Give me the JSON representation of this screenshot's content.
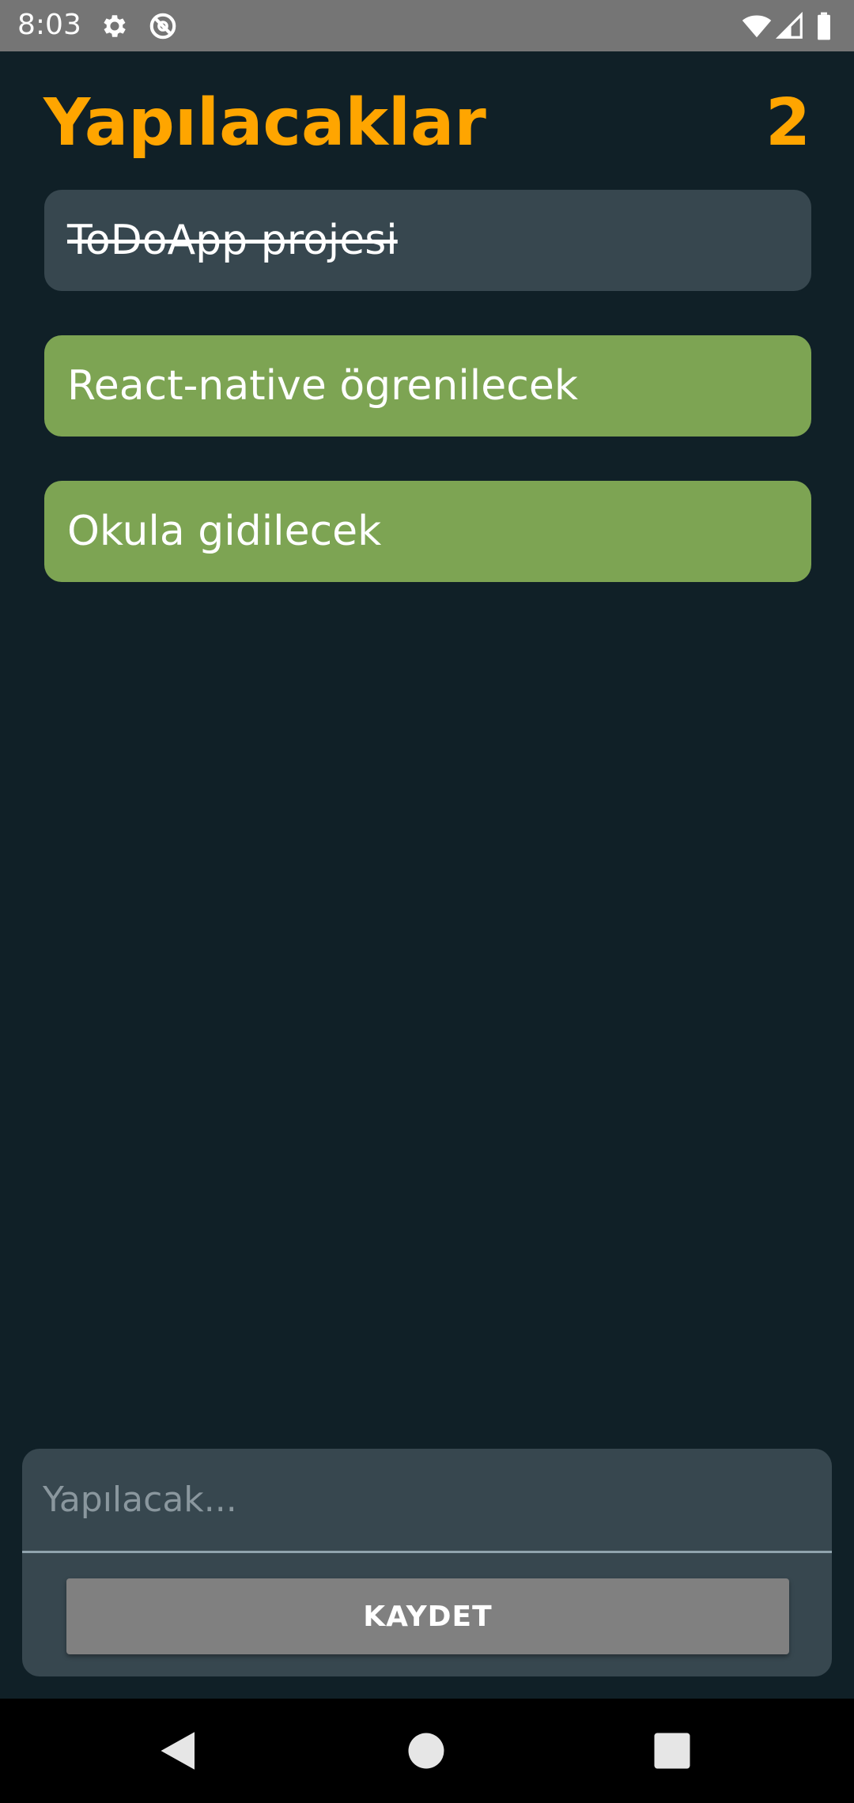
{
  "status_bar": {
    "time": "8:03",
    "icons": [
      "gear-icon",
      "do-not-disturb-icon",
      "wifi-icon",
      "cellular-signal-icon",
      "battery-icon"
    ],
    "background": "#757575"
  },
  "header": {
    "title": "Yapılacaklar",
    "count": "2",
    "color": "#FFA500"
  },
  "todos": [
    {
      "text": "ToDoApp projesi",
      "done": true
    },
    {
      "text": "React-native ögrenilecek",
      "done": false
    },
    {
      "text": "Okula gidilecek",
      "done": false
    }
  ],
  "form": {
    "input_placeholder": "Yapılacak...",
    "input_value": "",
    "save_label": "KAYDET"
  },
  "nav_bar": {
    "buttons": [
      "back-icon",
      "home-icon",
      "recents-icon"
    ]
  },
  "colors": {
    "background": "#102027",
    "done_item": "#37474F",
    "active_item": "#7DA453",
    "button": "#808080"
  }
}
